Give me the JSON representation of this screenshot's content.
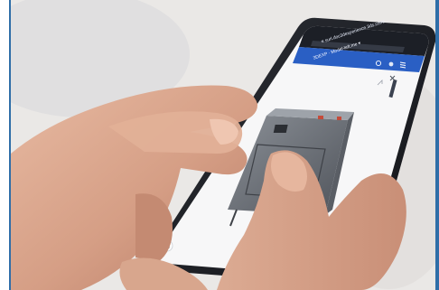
{
  "screen": {
    "url_text": "≡  surl.doc3dexperience.3ds.com/...",
    "tab_text": "3DEXP · Model-left.me ▾"
  },
  "colors": {
    "page_border": "#2f6ea8",
    "phone_body": "#1b1d22",
    "browser_bar": "#2a5fc4",
    "viewport": "#f7f7f8",
    "model": "#6e7279",
    "skin": "#d9a58c"
  },
  "icons": [
    "menu-icon",
    "search-icon",
    "share-icon",
    "close-icon",
    "maximize-icon"
  ]
}
